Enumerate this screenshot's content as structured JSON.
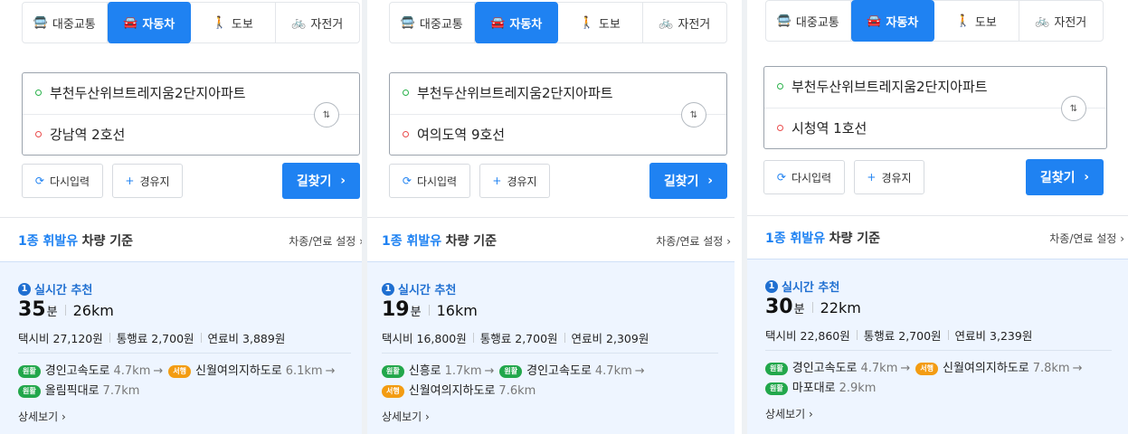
{
  "tabs": [
    {
      "label": "대중교통",
      "icon": "bus-icon",
      "glyph": "🚍",
      "active": false
    },
    {
      "label": "자동차",
      "icon": "car-icon",
      "glyph": "🚘",
      "active": true
    },
    {
      "label": "도보",
      "icon": "walk-icon",
      "glyph": "🚶",
      "active": false
    },
    {
      "label": "자전거",
      "icon": "bicycle-icon",
      "glyph": "🚲",
      "active": false
    }
  ],
  "buttons": {
    "reset": "다시입력",
    "reset_glyph": "⟳",
    "waypoint": "경유지",
    "waypoint_glyph": "+",
    "find": "길찾기",
    "find_glyph": "›",
    "swap_glyph": "⇅"
  },
  "vehicle": {
    "fuel": "1종 휘발유",
    "base": "차량 기준",
    "setting": "차종/연료 설정",
    "setting_glyph": "›"
  },
  "labels": {
    "rec_num": "1",
    "rec": "실시간 추천",
    "min_unit": "분",
    "taxi": "택시비",
    "toll": "통행료",
    "fuel_cost": "연료비",
    "detail": "상세보기",
    "detail_glyph": "›",
    "arrow": "→"
  },
  "colors": {
    "accent": "#1f82f2",
    "start_dot": "#2ab24b",
    "end_dot": "#ea4b4b",
    "badge_green": "#22a74b",
    "badge_orange": "#f39c12",
    "result_bg": "#eef5ff"
  },
  "panels": [
    {
      "start": "부천두산위브트레지움2단지아파트",
      "end": "강남역 2호선",
      "minutes": "35",
      "distance": "26km",
      "taxi": "27,120원",
      "toll": "2,700원",
      "fuel_cost": "3,889원",
      "road_lines": [
        [
          {
            "badge": "원활",
            "badge_color": "green",
            "name": "경인고속도로",
            "km": "4.7km",
            "arrow": true
          },
          {
            "badge": "서행",
            "badge_color": "orange",
            "name": "신월여의지하도로",
            "km": "6.1km",
            "arrow": true
          }
        ],
        [
          {
            "badge": "원활",
            "badge_color": "green",
            "name": "올림픽대로",
            "km": "7.7km",
            "arrow": false
          }
        ]
      ]
    },
    {
      "start": "부천두산위브트레지움2단지아파트",
      "end": "여의도역 9호선",
      "minutes": "19",
      "distance": "16km",
      "taxi": "16,800원",
      "toll": "2,700원",
      "fuel_cost": "2,309원",
      "road_lines": [
        [
          {
            "badge": "원활",
            "badge_color": "green",
            "name": "신흥로",
            "km": "1.7km",
            "arrow": true
          },
          {
            "badge": "원활",
            "badge_color": "green",
            "name": "경인고속도로",
            "km": "4.7km",
            "arrow": true
          }
        ],
        [
          {
            "badge": "서행",
            "badge_color": "orange",
            "name": "신월여의지하도로",
            "km": "7.6km",
            "arrow": false
          }
        ]
      ]
    },
    {
      "start": "부천두산위브트레지움2단지아파트",
      "end": "시청역 1호선",
      "minutes": "30",
      "distance": "22km",
      "taxi": "22,860원",
      "toll": "2,700원",
      "fuel_cost": "3,239원",
      "road_lines": [
        [
          {
            "badge": "원활",
            "badge_color": "green",
            "name": "경인고속도로",
            "km": "4.7km",
            "arrow": true
          },
          {
            "badge": "서행",
            "badge_color": "orange",
            "name": "신월여의지하도로",
            "km": "7.8km",
            "arrow": true
          }
        ],
        [
          {
            "badge": "원활",
            "badge_color": "green",
            "name": "마포대로",
            "km": "2.9km",
            "arrow": false
          }
        ]
      ]
    }
  ]
}
